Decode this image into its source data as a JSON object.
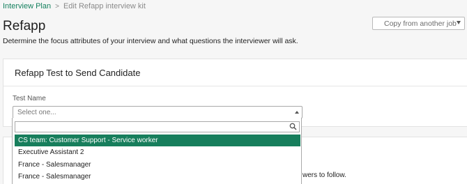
{
  "breadcrumb": {
    "parent": "Interview Plan",
    "separator": ">",
    "current": "Edit Refapp interview kit"
  },
  "page": {
    "title": "Refapp",
    "description": "Determine the focus attributes of your interview and what questions the interviewer will ask."
  },
  "copy_select": {
    "value": "Copy from another job"
  },
  "card": {
    "title": "Refapp Test to Send Candidate",
    "field_label": "Test Name",
    "select_placeholder": "Select one..."
  },
  "dropdown": {
    "search_value": "",
    "options": [
      {
        "label": "CS team: Customer Support - Service worker",
        "highlighted": true
      },
      {
        "label": "Executive Assistant 2",
        "highlighted": false
      },
      {
        "label": "France - Salesmanager",
        "highlighted": false
      },
      {
        "label": "France - Salesmanager",
        "highlighted": false
      }
    ]
  },
  "card2": {
    "partial_text": "wers to follow."
  },
  "colors": {
    "accent_green": "#177e5c",
    "link_green": "#15805e"
  },
  "icons": {
    "breadcrumb_separator": "chevron-right-icon",
    "search": "search-icon",
    "dropdown_caret": "caret-down-icon",
    "select_caret": "caret-up-icon"
  }
}
